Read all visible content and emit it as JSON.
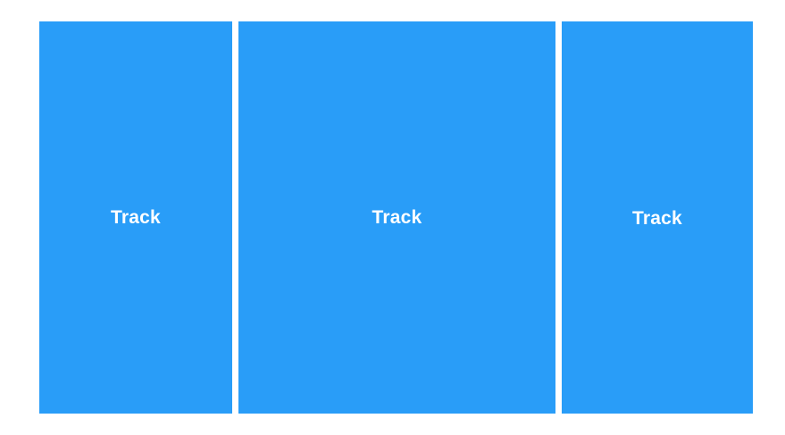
{
  "tracks": [
    {
      "label": "Track"
    },
    {
      "label": "Track"
    },
    {
      "label": "Track"
    }
  ],
  "colors": {
    "track_fill": "#299DF8",
    "label": "#FFFFFF",
    "background": "#FFFFFF"
  }
}
